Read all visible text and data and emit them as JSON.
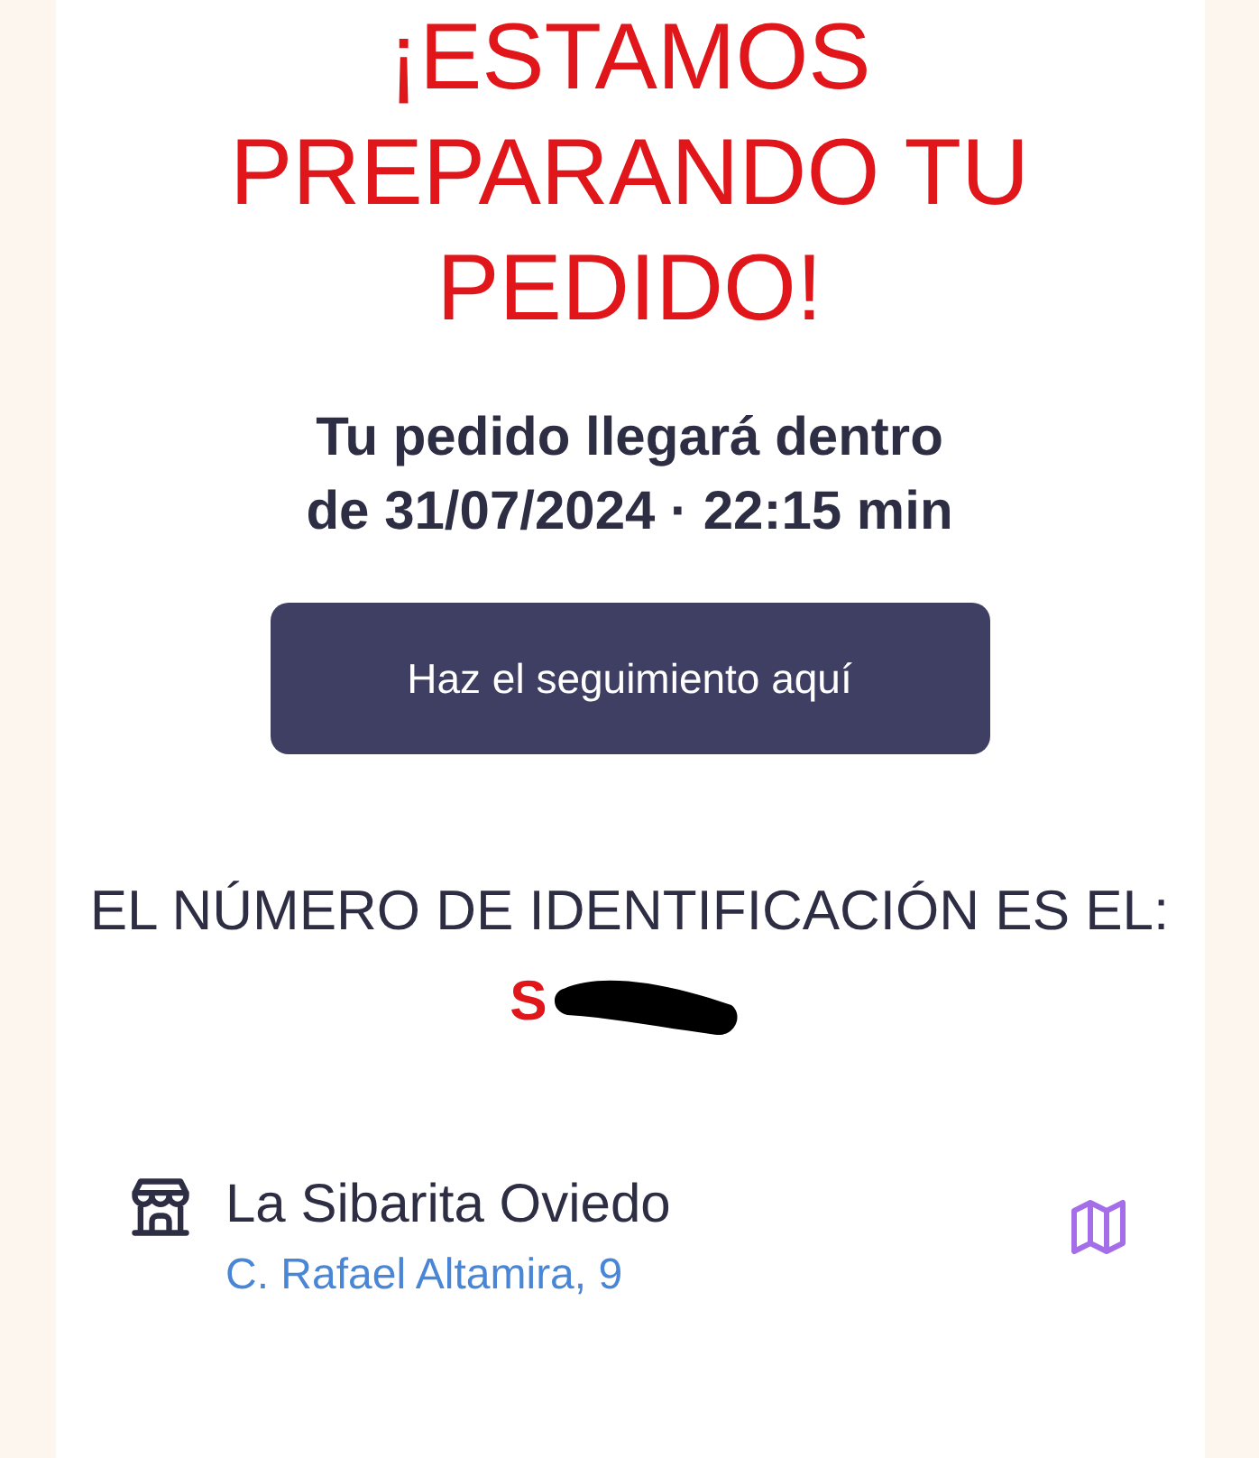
{
  "headline": [
    "¡ESTAMOS",
    "PREPARANDO TU",
    "PEDIDO!"
  ],
  "delivery": [
    "Tu pedido llegará dentro",
    "de 31/07/2024 · 22:15 min"
  ],
  "track_button": {
    "label": "Haz el seguimiento aquí"
  },
  "identification": {
    "label": "EL NÚMERO DE IDENTIFICACIÓN ES EL:",
    "value": "S"
  },
  "store": {
    "name": "La Sibarita Oviedo",
    "address": "C. Rafael Altamira, 9"
  }
}
